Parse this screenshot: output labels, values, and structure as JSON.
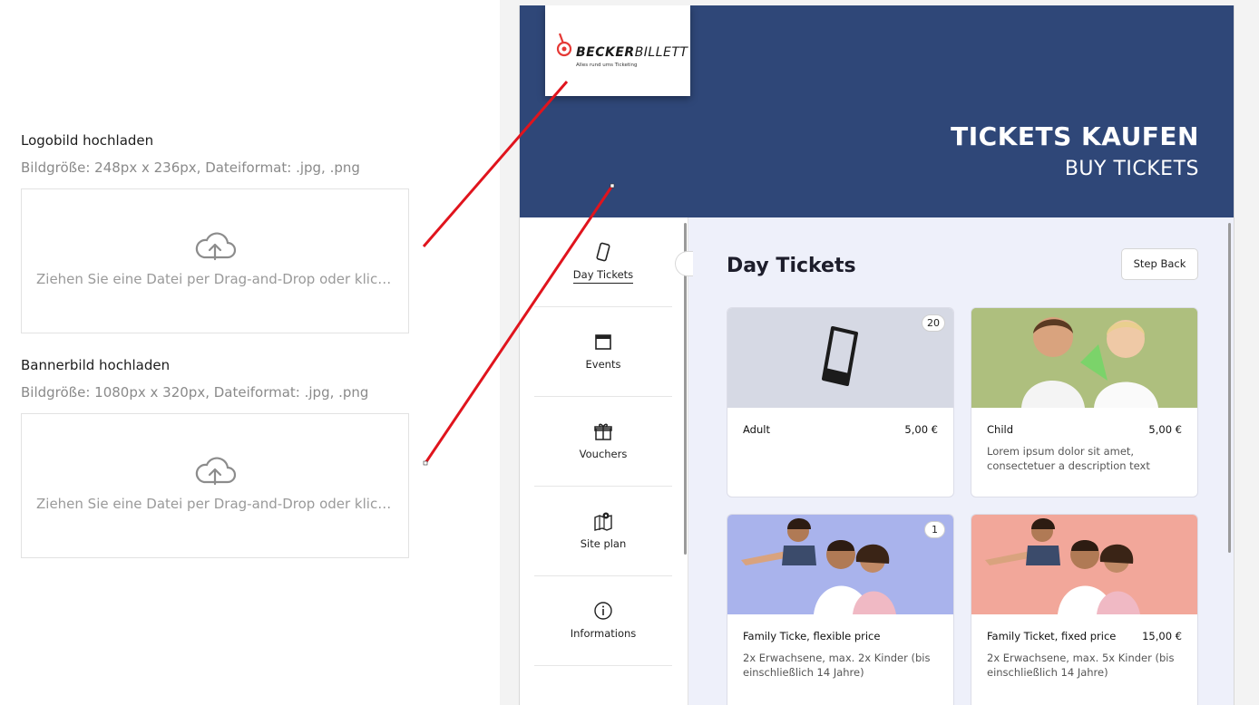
{
  "uploads": {
    "logo": {
      "title": "Logobild hochladen",
      "hint": "Bildgröße: 248px x 236px, Dateiformat: .jpg, .png",
      "dropzone_text": "Ziehen Sie eine Datei per Drag-and-Drop oder klicken Sie hier"
    },
    "banner": {
      "title": "Bannerbild hochladen",
      "hint": "Bildgröße: 1080px x 320px, Dateiformat: .jpg, .png",
      "dropzone_text": "Ziehen Sie eine Datei per Drag-and-Drop oder klicken Sie hier"
    }
  },
  "preview": {
    "logo": {
      "brand_part1": "BECKER",
      "brand_part2": "BILLETT",
      "tagline": "Alles rund ums Ticketing"
    },
    "banner": {
      "title": "TICKETS KAUFEN",
      "subtitle": "BUY TICKETS"
    },
    "sidebar": {
      "items": [
        {
          "label": "Day Tickets",
          "icon": "ticket-icon"
        },
        {
          "label": "Events",
          "icon": "calendar-icon"
        },
        {
          "label": "Vouchers",
          "icon": "gift-icon"
        },
        {
          "label": "Site plan",
          "icon": "map-icon"
        },
        {
          "label": "Informations",
          "icon": "info-icon"
        }
      ]
    },
    "content": {
      "title": "Day Tickets",
      "step_back": "Step Back",
      "cards": [
        {
          "name": "Adult",
          "price": "5,00 €",
          "badge": "20",
          "description": ""
        },
        {
          "name": "Child",
          "price": "5,00 €",
          "badge": "",
          "description": "Lorem ipsum dolor sit amet, consectetuer a description text"
        },
        {
          "name": "Family Ticke, flexible price",
          "price": "",
          "badge": "1",
          "description": "2x Erwachsene, max. 2x Kinder (bis einschließlich 14 Jahre)"
        },
        {
          "name": "Family Ticket, fixed price",
          "price": "15,00 €",
          "badge": "",
          "description": "2x Erwachsene, max. 5x Kinder (bis einschließlich 14 Jahre)"
        }
      ]
    }
  },
  "colors": {
    "banner": "#2f4778",
    "content_bg": "#eef0fa",
    "connector": "#e0141d",
    "logo_red": "#e53935"
  }
}
